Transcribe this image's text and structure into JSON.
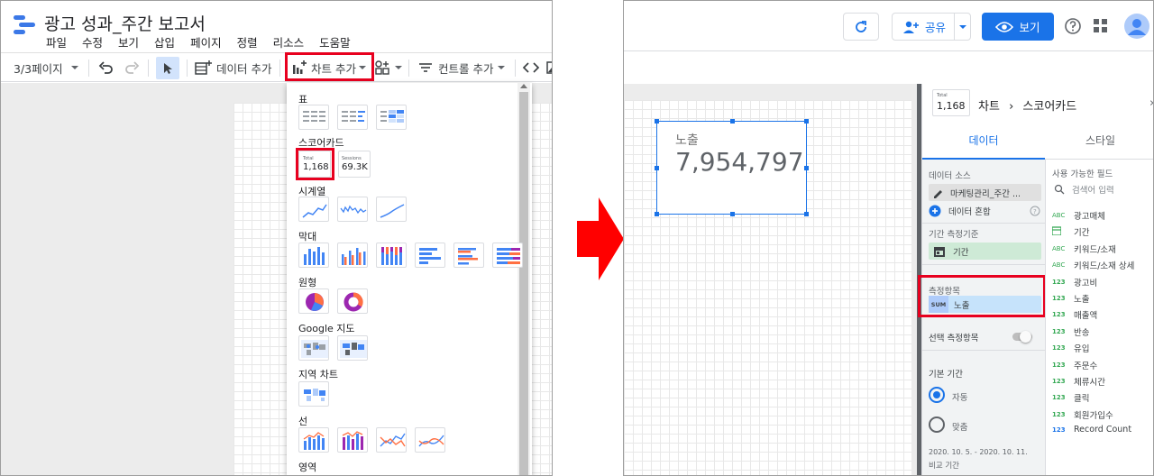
{
  "left": {
    "title": "광고 성과_주간 보고서",
    "menu": [
      "파일",
      "수정",
      "보기",
      "삽입",
      "페이지",
      "정렬",
      "리소스",
      "도움말"
    ],
    "toolbar": {
      "page_indicator": "3/3페이지",
      "add_data": "데이터 추가",
      "add_chart": "차트 추가",
      "add_control": "컨트롤 추가"
    },
    "chart_menu": {
      "sections": {
        "table": "표",
        "scorecard": "스코어카드",
        "timeseries": "시계열",
        "bar": "막대",
        "pie": "원형",
        "geo": "Google 지도",
        "geomap": "지역 차트",
        "line": "선",
        "area": "영역"
      },
      "scorecard_options": [
        {
          "label": "Total",
          "value": "1,168"
        },
        {
          "label": "Sessions",
          "value": "69.3K"
        }
      ]
    }
  },
  "right": {
    "header": {
      "share": "공유",
      "view": "보기"
    },
    "scorecard": {
      "label": "노출",
      "value": "7,954,797"
    },
    "props": {
      "thumb_label": "Total",
      "thumb_value": "1,168",
      "breadcrumb_chart": "차트",
      "breadcrumb_type": "스코어카드",
      "tab_data": "데이터",
      "tab_style": "스타일",
      "data_source_title": "데이터 소스",
      "data_source_name": "마케팅관리_주간 ...",
      "blend": "데이터 혼합",
      "date_dim_title": "기간 측정기준",
      "date_dim": "기간",
      "metric_title": "측정항목",
      "metric_agg": "SUM",
      "metric_name": "노출",
      "optional_metrics": "선택 측정항목",
      "default_period": "기본 기간",
      "auto": "자동",
      "custom": "맞춤",
      "range": "2020. 10. 5. - 2020. 10. 11.",
      "compare": "비교 기간",
      "available_fields": "사용 가능한 필드",
      "search_placeholder": "검색어 입력",
      "fields": [
        {
          "type": "ABC",
          "name": "광고매체"
        },
        {
          "type": "cal",
          "name": "기간"
        },
        {
          "type": "ABC",
          "name": "키워드/소재"
        },
        {
          "type": "ABC",
          "name": "키워드/소재 상세"
        },
        {
          "type": "123",
          "name": "광고비"
        },
        {
          "type": "123",
          "name": "노출"
        },
        {
          "type": "123",
          "name": "매출액"
        },
        {
          "type": "123",
          "name": "반송"
        },
        {
          "type": "123",
          "name": "유입"
        },
        {
          "type": "123",
          "name": "주문수"
        },
        {
          "type": "123",
          "name": "체류시간"
        },
        {
          "type": "123",
          "name": "클릭"
        },
        {
          "type": "123",
          "name": "회원가입수"
        },
        {
          "type": "123",
          "name": "Record Count"
        }
      ]
    }
  },
  "colors": {
    "accent": "#1a73e8",
    "highlight": "#e8001f",
    "arrow": "#ff0000",
    "metric_chip": "#c6e3fb",
    "dim_chip": "#ceead6"
  }
}
